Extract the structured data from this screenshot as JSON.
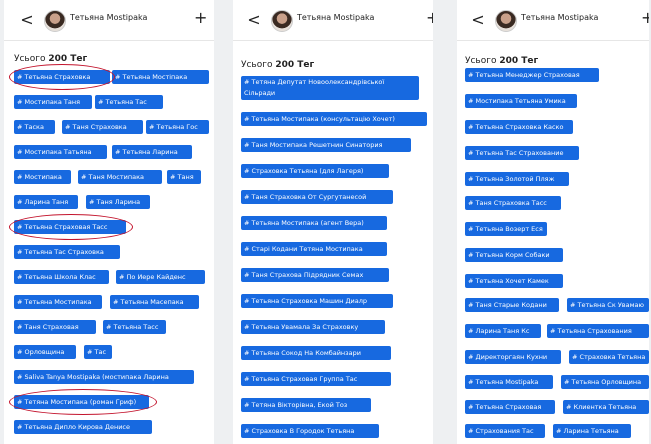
{
  "colors": {
    "tag_bg": "#1769e0",
    "tag_text": "#ffffff",
    "highlight_ring": "#c3142d"
  },
  "icons": {
    "back": "chevron-left-icon",
    "add": "plus-icon",
    "avatar": "user-avatar"
  },
  "panels": [
    {
      "header": {
        "back": "<",
        "name": "Тетьяна Mostipaka",
        "plus": "+"
      },
      "count": {
        "prefix": "Усього",
        "value": "200 Тег"
      },
      "tags": [
        "# Тетьяна Страховка",
        "# Тетьяна Мостіпака",
        "# Мостипака Таня",
        "# Тетьяна Тас",
        "# Таска",
        "# Таня Страховка",
        "# Тетьяна Гос",
        "# Мостипака Татьяна",
        "# Тетьяна Ларина",
        "# Мостипака",
        "# Таня Мостипака",
        "# Таня",
        "# Ларина Таня",
        "# Таня Ларина",
        "# Тетьяна Страховая Тасс",
        "# Тетьяна Тас Страховка",
        "# Тетьяна Школа Клас",
        "# По Иере Кайденс",
        "# Тетьяна Мостипака",
        "# Тетьяна Масепака",
        "# Таня Страховая",
        "# Тетьяна Тасс",
        "# Орловщина",
        "# Тас",
        "# Saliva Tanya Mostipaka (мостипака Ларина",
        "# Тетяна Мостипака (роман Гриф)",
        "# Тетьяна Дипло Кирова Денисе"
      ]
    },
    {
      "header": {
        "back": "<",
        "name": "Тетьяна Mostipaka",
        "plus": "+"
      },
      "count": {
        "prefix": "Усього",
        "value": "200 Тег"
      },
      "tags": [
        "# Тетяна Депутат Новоолександрівської Сільради",
        "# Тетьяна Мостипака (консультацію Хочет)",
        "# Таня Мостипака Решетнин Синатория",
        "# Страховка Тетьяна (для Лагеря)",
        "# Таня Страховка От Сургутанесой",
        "# Тетьяна Мостипака (агент Вера)",
        "# Старі Кодани Тетяна Мостипака",
        "# Таня Страхова Підрядник Семах",
        "# Тетьяна Страховка Машин Диалр",
        "# Тетьяна Увамала За Страховку",
        "# Тетьяна Сокод На Комбайнзари",
        "# Тетьяна Страховая Группа Тас",
        "# Тетяна Вікторівна, Екой Тоз",
        "# Страховка В Городок Тетьяна"
      ]
    },
    {
      "header": {
        "back": "<",
        "name": "Тетьяна Mostipaka",
        "plus": "+"
      },
      "count": {
        "prefix": "Усього",
        "value": "200 Тег"
      },
      "tags": [
        "# Тетьяна Менеджер Страховая",
        "# Мостипака Тетьяна Умика",
        "# Тетьяна Страховка Каско",
        "# Тетьяна Тас Страхование",
        "# Тетьяна Золотой Пляж",
        "# Таня Страховка Тасс",
        "# Тетьяна Возерт Еся",
        "# Тетьяна Корм Собаки",
        "# Тетьяна Хочет Камек",
        "# Таня Старые Кодани",
        "# Тетьяна Ск Увамаю",
        "# Ларина Таня Кс",
        "# Тетьяна Страхования",
        "# Директоргаян Кухни",
        "# Страховка Тетьяна",
        "# Тетьяна Mostipaka",
        "# Тетьяна Орловщина",
        "# Тетьяна Страховая",
        "# Клиентка Тетьяна",
        "# Страхования Тас",
        "# Ларина Тетьяна"
      ]
    }
  ]
}
